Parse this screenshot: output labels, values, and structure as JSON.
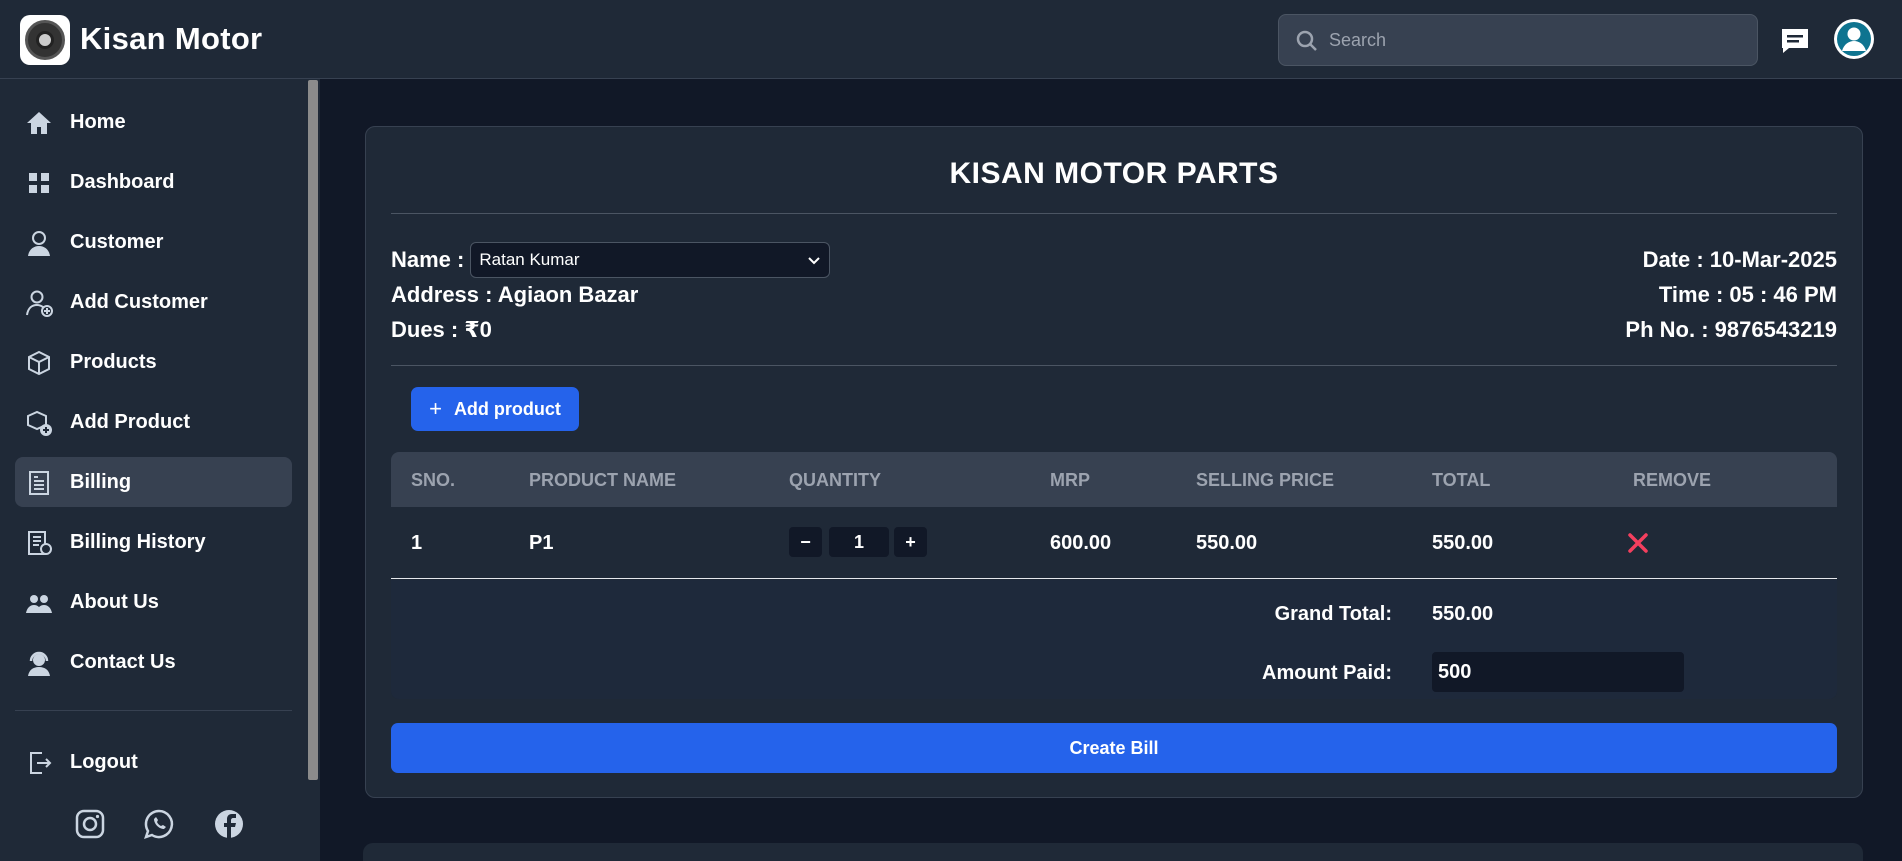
{
  "header": {
    "brand": "Kisan Motor",
    "search_placeholder": "Search"
  },
  "sidebar": {
    "items": [
      {
        "label": "Home",
        "icon": "home-icon"
      },
      {
        "label": "Dashboard",
        "icon": "dashboard-icon"
      },
      {
        "label": "Customer",
        "icon": "customer-icon"
      },
      {
        "label": "Add Customer",
        "icon": "add-customer-icon"
      },
      {
        "label": "Products",
        "icon": "products-icon"
      },
      {
        "label": "Add Product",
        "icon": "add-product-icon"
      },
      {
        "label": "Billing",
        "icon": "billing-icon",
        "active": true
      },
      {
        "label": "Billing History",
        "icon": "billing-history-icon"
      },
      {
        "label": "About Us",
        "icon": "about-us-icon"
      },
      {
        "label": "Contact Us",
        "icon": "contact-us-icon"
      }
    ],
    "logout_label": "Logout",
    "social": [
      "instagram-icon",
      "whatsapp-icon",
      "facebook-icon"
    ]
  },
  "bill": {
    "title": "KISAN MOTOR PARTS",
    "name_label": "Name :",
    "name_value": "Ratan Kumar",
    "address": "Address : Agiaon Bazar",
    "dues": "Dues : ₹0",
    "date": "Date : 10-Mar-2025",
    "time": "Time : 05 : 46 PM",
    "phone": "Ph No. : 9876543219",
    "add_product_label": "Add product",
    "columns": [
      "SNO.",
      "PRODUCT NAME",
      "QUANTITY",
      "MRP",
      "SELLING PRICE",
      "TOTAL",
      "REMOVE"
    ],
    "rows": [
      {
        "sno": "1",
        "product": "P1",
        "quantity": "1",
        "mrp": "600.00",
        "selling_price": "550.00",
        "total": "550.00"
      }
    ],
    "qty_minus": "−",
    "qty_plus": "+",
    "grand_total_label": "Grand Total:",
    "grand_total_value": "550.00",
    "amount_paid_label": "Amount Paid:",
    "amount_paid_value": "500",
    "create_bill_label": "Create Bill"
  },
  "colors": {
    "accent": "#2563eb",
    "background": "#111827",
    "panel": "#1f2937",
    "remove": "#f43f5e"
  }
}
